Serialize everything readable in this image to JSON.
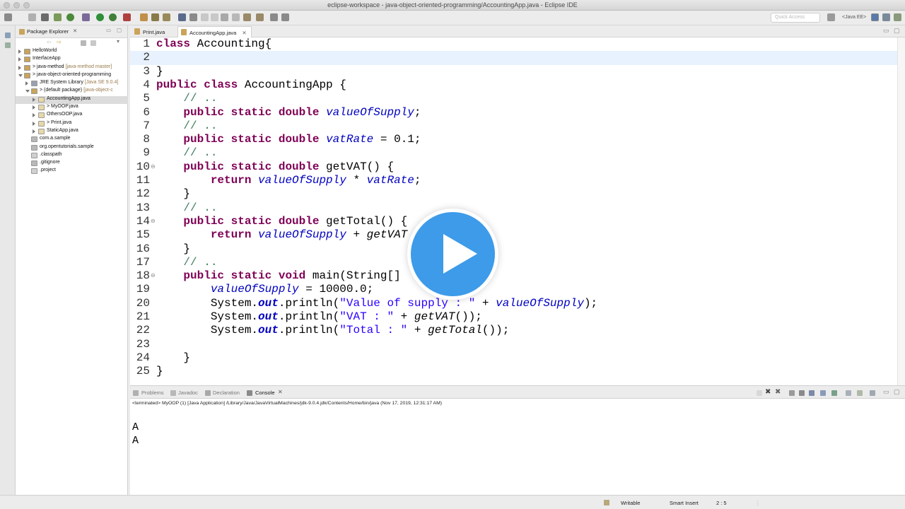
{
  "window": {
    "title": "eclipse-workspace - java-object-oriented-programming/AccountingApp.java - Eclipse IDE"
  },
  "toolbar": {
    "quick_access_placeholder": "Quick Access",
    "perspective_label": "<Java EE>"
  },
  "package_explorer": {
    "title": "Package Explorer",
    "items": [
      {
        "label": "HelloWorld",
        "decoration": "",
        "indent": 0,
        "expanded": false,
        "selected": false,
        "icon": "project-icon"
      },
      {
        "label": "InterfaceApp",
        "decoration": "",
        "indent": 0,
        "expanded": false,
        "selected": false,
        "icon": "project-icon"
      },
      {
        "label": "> java-method",
        "decoration": "[java-method master]",
        "indent": 0,
        "expanded": false,
        "selected": false,
        "icon": "project-icon"
      },
      {
        "label": "> java-object-oriented-programming",
        "decoration": "",
        "indent": 0,
        "expanded": true,
        "selected": false,
        "icon": "project-icon"
      },
      {
        "label": "JRE System Library",
        "decoration": "[Java SE 9.0.4]",
        "indent": 1,
        "expanded": false,
        "selected": false,
        "icon": "library-icon"
      },
      {
        "label": "> (default package)",
        "decoration": "[java-object-c",
        "indent": 1,
        "expanded": true,
        "selected": false,
        "icon": "package-icon"
      },
      {
        "label": "AccountingApp.java",
        "decoration": "",
        "indent": 2,
        "expanded": false,
        "selected": true,
        "icon": "java-file-icon"
      },
      {
        "label": "> MyOOP.java",
        "decoration": "",
        "indent": 2,
        "expanded": false,
        "selected": false,
        "icon": "java-file-icon"
      },
      {
        "label": "OthersOOP.java",
        "decoration": "",
        "indent": 2,
        "expanded": false,
        "selected": false,
        "icon": "java-file-icon"
      },
      {
        "label": "> Print.java",
        "decoration": "",
        "indent": 2,
        "expanded": false,
        "selected": false,
        "icon": "java-file-icon"
      },
      {
        "label": "StaticApp.java",
        "decoration": "",
        "indent": 2,
        "expanded": false,
        "selected": false,
        "icon": "java-file-icon"
      },
      {
        "label": "com.a.sample",
        "decoration": "",
        "indent": 1,
        "expanded": null,
        "selected": false,
        "icon": "file-icon"
      },
      {
        "label": "org.opentutorials.sample",
        "decoration": "",
        "indent": 1,
        "expanded": null,
        "selected": false,
        "icon": "file-icon"
      },
      {
        "label": ".classpath",
        "decoration": "",
        "indent": 1,
        "expanded": null,
        "selected": false,
        "icon": "xml-file-icon"
      },
      {
        "label": ".gitignore",
        "decoration": "",
        "indent": 1,
        "expanded": null,
        "selected": false,
        "icon": "file-icon"
      },
      {
        "label": ".project",
        "decoration": "",
        "indent": 1,
        "expanded": null,
        "selected": false,
        "icon": "xml-file-icon"
      }
    ]
  },
  "editor": {
    "tabs": [
      {
        "label": "Print.java",
        "active": false
      },
      {
        "label": "AccountingApp.java",
        "active": true
      }
    ],
    "current_line": 2,
    "lines": [
      {
        "n": "1",
        "fold": "",
        "tokens": [
          [
            "kw",
            "class"
          ],
          [
            "",
            " Accounting{"
          ]
        ]
      },
      {
        "n": "2",
        "fold": "",
        "tokens": []
      },
      {
        "n": "3",
        "fold": "",
        "tokens": [
          [
            "",
            "}"
          ]
        ]
      },
      {
        "n": "4",
        "fold": "",
        "tokens": [
          [
            "kw",
            "public"
          ],
          [
            "",
            " "
          ],
          [
            "kw",
            "class"
          ],
          [
            "",
            " AccountingApp {"
          ]
        ]
      },
      {
        "n": "5",
        "fold": "",
        "tokens": [
          [
            "",
            "    "
          ],
          [
            "cm",
            "// .."
          ]
        ]
      },
      {
        "n": "6",
        "fold": "",
        "tokens": [
          [
            "",
            "    "
          ],
          [
            "kw",
            "public"
          ],
          [
            "",
            " "
          ],
          [
            "kw",
            "static"
          ],
          [
            "",
            " "
          ],
          [
            "kw",
            "double"
          ],
          [
            "",
            " "
          ],
          [
            "fld",
            "valueOfSupply"
          ],
          [
            "",
            ";"
          ]
        ]
      },
      {
        "n": "7",
        "fold": "",
        "tokens": [
          [
            "",
            "    "
          ],
          [
            "cm",
            "// .."
          ]
        ]
      },
      {
        "n": "8",
        "fold": "",
        "tokens": [
          [
            "",
            "    "
          ],
          [
            "kw",
            "public"
          ],
          [
            "",
            " "
          ],
          [
            "kw",
            "static"
          ],
          [
            "",
            " "
          ],
          [
            "kw",
            "double"
          ],
          [
            "",
            " "
          ],
          [
            "fld",
            "vatRate"
          ],
          [
            "",
            " = 0.1;"
          ]
        ]
      },
      {
        "n": "9",
        "fold": "",
        "tokens": [
          [
            "",
            "    "
          ],
          [
            "cm",
            "// .."
          ]
        ]
      },
      {
        "n": "10",
        "fold": "⊖",
        "tokens": [
          [
            "",
            "    "
          ],
          [
            "kw",
            "public"
          ],
          [
            "",
            " "
          ],
          [
            "kw",
            "static"
          ],
          [
            "",
            " "
          ],
          [
            "kw",
            "double"
          ],
          [
            "",
            " getVAT() {"
          ]
        ]
      },
      {
        "n": "11",
        "fold": "",
        "tokens": [
          [
            "",
            "        "
          ],
          [
            "kw",
            "return"
          ],
          [
            "",
            " "
          ],
          [
            "fld",
            "valueOfSupply"
          ],
          [
            "",
            " * "
          ],
          [
            "fld",
            "vatRate"
          ],
          [
            "",
            ";"
          ]
        ]
      },
      {
        "n": "12",
        "fold": "",
        "tokens": [
          [
            "",
            "    }"
          ]
        ]
      },
      {
        "n": "13",
        "fold": "",
        "tokens": [
          [
            "",
            "    "
          ],
          [
            "cm",
            "// .."
          ]
        ]
      },
      {
        "n": "14",
        "fold": "⊖",
        "tokens": [
          [
            "",
            "    "
          ],
          [
            "kw",
            "public"
          ],
          [
            "",
            " "
          ],
          [
            "kw",
            "static"
          ],
          [
            "",
            " "
          ],
          [
            "kw",
            "double"
          ],
          [
            "",
            " getTotal() {"
          ]
        ]
      },
      {
        "n": "15",
        "fold": "",
        "tokens": [
          [
            "",
            "        "
          ],
          [
            "kw",
            "return"
          ],
          [
            "",
            " "
          ],
          [
            "fld",
            "valueOfSupply"
          ],
          [
            "",
            " + "
          ],
          [
            "st",
            "getVAT"
          ]
        ]
      },
      {
        "n": "16",
        "fold": "",
        "tokens": [
          [
            "",
            "    }"
          ]
        ]
      },
      {
        "n": "17",
        "fold": "",
        "tokens": [
          [
            "",
            "    "
          ],
          [
            "cm",
            "// .."
          ]
        ]
      },
      {
        "n": "18",
        "fold": "⊖",
        "tokens": [
          [
            "",
            "    "
          ],
          [
            "kw",
            "public"
          ],
          [
            "",
            " "
          ],
          [
            "kw",
            "static"
          ],
          [
            "",
            " "
          ],
          [
            "kw",
            "void"
          ],
          [
            "",
            " main(String[]"
          ]
        ]
      },
      {
        "n": "19",
        "fold": "",
        "tokens": [
          [
            "",
            "        "
          ],
          [
            "fld",
            "valueOfSupply"
          ],
          [
            "",
            " = 10000.0;"
          ]
        ]
      },
      {
        "n": "20",
        "fold": "",
        "tokens": [
          [
            "",
            "        System."
          ],
          [
            "sout",
            "out"
          ],
          [
            "",
            ".println("
          ],
          [
            "str",
            "\"Value of supply : \""
          ],
          [
            "",
            " + "
          ],
          [
            "fld",
            "valueOfSupply"
          ],
          [
            "",
            ");"
          ]
        ]
      },
      {
        "n": "21",
        "fold": "",
        "tokens": [
          [
            "",
            "        System."
          ],
          [
            "sout",
            "out"
          ],
          [
            "",
            ".println("
          ],
          [
            "str",
            "\"VAT : \""
          ],
          [
            "",
            " + "
          ],
          [
            "st",
            "getVAT"
          ],
          [
            "",
            "());"
          ]
        ]
      },
      {
        "n": "22",
        "fold": "",
        "tokens": [
          [
            "",
            "        System."
          ],
          [
            "sout",
            "out"
          ],
          [
            "",
            ".println("
          ],
          [
            "str",
            "\"Total : \""
          ],
          [
            "",
            " + "
          ],
          [
            "st",
            "getTotal"
          ],
          [
            "",
            "());"
          ]
        ]
      },
      {
        "n": "23",
        "fold": "",
        "tokens": []
      },
      {
        "n": "24",
        "fold": "",
        "tokens": [
          [
            "",
            "    }"
          ]
        ]
      },
      {
        "n": "25",
        "fold": "",
        "tokens": [
          [
            "",
            "}"
          ]
        ]
      }
    ]
  },
  "console": {
    "tabs": [
      {
        "label": "Problems",
        "active": false
      },
      {
        "label": "Javadoc",
        "active": false
      },
      {
        "label": "Declaration",
        "active": false
      },
      {
        "label": "Console",
        "active": true
      }
    ],
    "info": "<terminated> MyOOP (1) [Java Application] /Library/Java/JavaVirtualMachines/jdk-9.0.4.jdk/Contents/Home/bin/java (Nov 17, 2019, 12:31:17 AM)",
    "output": [
      "A",
      "A"
    ]
  },
  "statusbar": {
    "writable": "Writable",
    "insert_mode": "Smart Insert",
    "position": "2 : 5"
  },
  "colors": {
    "keyword": "#7f0055",
    "comment": "#3f7f5f",
    "field": "#0000c0",
    "string": "#2a00ff",
    "current_line": "#e8f2fe",
    "play_button": "#3d9be9"
  }
}
